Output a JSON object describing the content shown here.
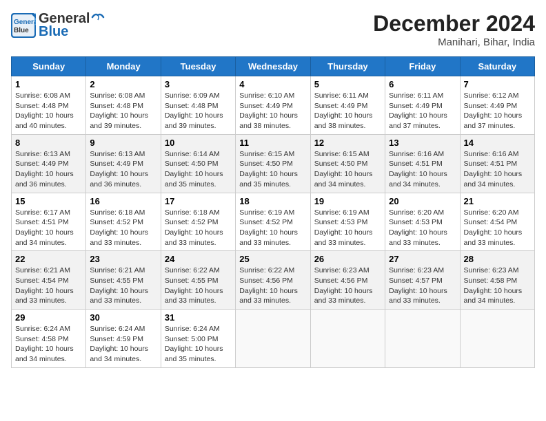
{
  "header": {
    "logo_line1": "General",
    "logo_line2": "Blue",
    "month_title": "December 2024",
    "location": "Manihari, Bihar, India"
  },
  "weekdays": [
    "Sunday",
    "Monday",
    "Tuesday",
    "Wednesday",
    "Thursday",
    "Friday",
    "Saturday"
  ],
  "weeks": [
    [
      {
        "day": "1",
        "text": "Sunrise: 6:08 AM\nSunset: 4:48 PM\nDaylight: 10 hours\nand 40 minutes."
      },
      {
        "day": "2",
        "text": "Sunrise: 6:08 AM\nSunset: 4:48 PM\nDaylight: 10 hours\nand 39 minutes."
      },
      {
        "day": "3",
        "text": "Sunrise: 6:09 AM\nSunset: 4:48 PM\nDaylight: 10 hours\nand 39 minutes."
      },
      {
        "day": "4",
        "text": "Sunrise: 6:10 AM\nSunset: 4:49 PM\nDaylight: 10 hours\nand 38 minutes."
      },
      {
        "day": "5",
        "text": "Sunrise: 6:11 AM\nSunset: 4:49 PM\nDaylight: 10 hours\nand 38 minutes."
      },
      {
        "day": "6",
        "text": "Sunrise: 6:11 AM\nSunset: 4:49 PM\nDaylight: 10 hours\nand 37 minutes."
      },
      {
        "day": "7",
        "text": "Sunrise: 6:12 AM\nSunset: 4:49 PM\nDaylight: 10 hours\nand 37 minutes."
      }
    ],
    [
      {
        "day": "8",
        "text": "Sunrise: 6:13 AM\nSunset: 4:49 PM\nDaylight: 10 hours\nand 36 minutes."
      },
      {
        "day": "9",
        "text": "Sunrise: 6:13 AM\nSunset: 4:49 PM\nDaylight: 10 hours\nand 36 minutes."
      },
      {
        "day": "10",
        "text": "Sunrise: 6:14 AM\nSunset: 4:50 PM\nDaylight: 10 hours\nand 35 minutes."
      },
      {
        "day": "11",
        "text": "Sunrise: 6:15 AM\nSunset: 4:50 PM\nDaylight: 10 hours\nand 35 minutes."
      },
      {
        "day": "12",
        "text": "Sunrise: 6:15 AM\nSunset: 4:50 PM\nDaylight: 10 hours\nand 34 minutes."
      },
      {
        "day": "13",
        "text": "Sunrise: 6:16 AM\nSunset: 4:51 PM\nDaylight: 10 hours\nand 34 minutes."
      },
      {
        "day": "14",
        "text": "Sunrise: 6:16 AM\nSunset: 4:51 PM\nDaylight: 10 hours\nand 34 minutes."
      }
    ],
    [
      {
        "day": "15",
        "text": "Sunrise: 6:17 AM\nSunset: 4:51 PM\nDaylight: 10 hours\nand 34 minutes."
      },
      {
        "day": "16",
        "text": "Sunrise: 6:18 AM\nSunset: 4:52 PM\nDaylight: 10 hours\nand 33 minutes."
      },
      {
        "day": "17",
        "text": "Sunrise: 6:18 AM\nSunset: 4:52 PM\nDaylight: 10 hours\nand 33 minutes."
      },
      {
        "day": "18",
        "text": "Sunrise: 6:19 AM\nSunset: 4:52 PM\nDaylight: 10 hours\nand 33 minutes."
      },
      {
        "day": "19",
        "text": "Sunrise: 6:19 AM\nSunset: 4:53 PM\nDaylight: 10 hours\nand 33 minutes."
      },
      {
        "day": "20",
        "text": "Sunrise: 6:20 AM\nSunset: 4:53 PM\nDaylight: 10 hours\nand 33 minutes."
      },
      {
        "day": "21",
        "text": "Sunrise: 6:20 AM\nSunset: 4:54 PM\nDaylight: 10 hours\nand 33 minutes."
      }
    ],
    [
      {
        "day": "22",
        "text": "Sunrise: 6:21 AM\nSunset: 4:54 PM\nDaylight: 10 hours\nand 33 minutes."
      },
      {
        "day": "23",
        "text": "Sunrise: 6:21 AM\nSunset: 4:55 PM\nDaylight: 10 hours\nand 33 minutes."
      },
      {
        "day": "24",
        "text": "Sunrise: 6:22 AM\nSunset: 4:55 PM\nDaylight: 10 hours\nand 33 minutes."
      },
      {
        "day": "25",
        "text": "Sunrise: 6:22 AM\nSunset: 4:56 PM\nDaylight: 10 hours\nand 33 minutes."
      },
      {
        "day": "26",
        "text": "Sunrise: 6:23 AM\nSunset: 4:56 PM\nDaylight: 10 hours\nand 33 minutes."
      },
      {
        "day": "27",
        "text": "Sunrise: 6:23 AM\nSunset: 4:57 PM\nDaylight: 10 hours\nand 33 minutes."
      },
      {
        "day": "28",
        "text": "Sunrise: 6:23 AM\nSunset: 4:58 PM\nDaylight: 10 hours\nand 34 minutes."
      }
    ],
    [
      {
        "day": "29",
        "text": "Sunrise: 6:24 AM\nSunset: 4:58 PM\nDaylight: 10 hours\nand 34 minutes."
      },
      {
        "day": "30",
        "text": "Sunrise: 6:24 AM\nSunset: 4:59 PM\nDaylight: 10 hours\nand 34 minutes."
      },
      {
        "day": "31",
        "text": "Sunrise: 6:24 AM\nSunset: 5:00 PM\nDaylight: 10 hours\nand 35 minutes."
      },
      {
        "day": "",
        "text": ""
      },
      {
        "day": "",
        "text": ""
      },
      {
        "day": "",
        "text": ""
      },
      {
        "day": "",
        "text": ""
      }
    ]
  ]
}
